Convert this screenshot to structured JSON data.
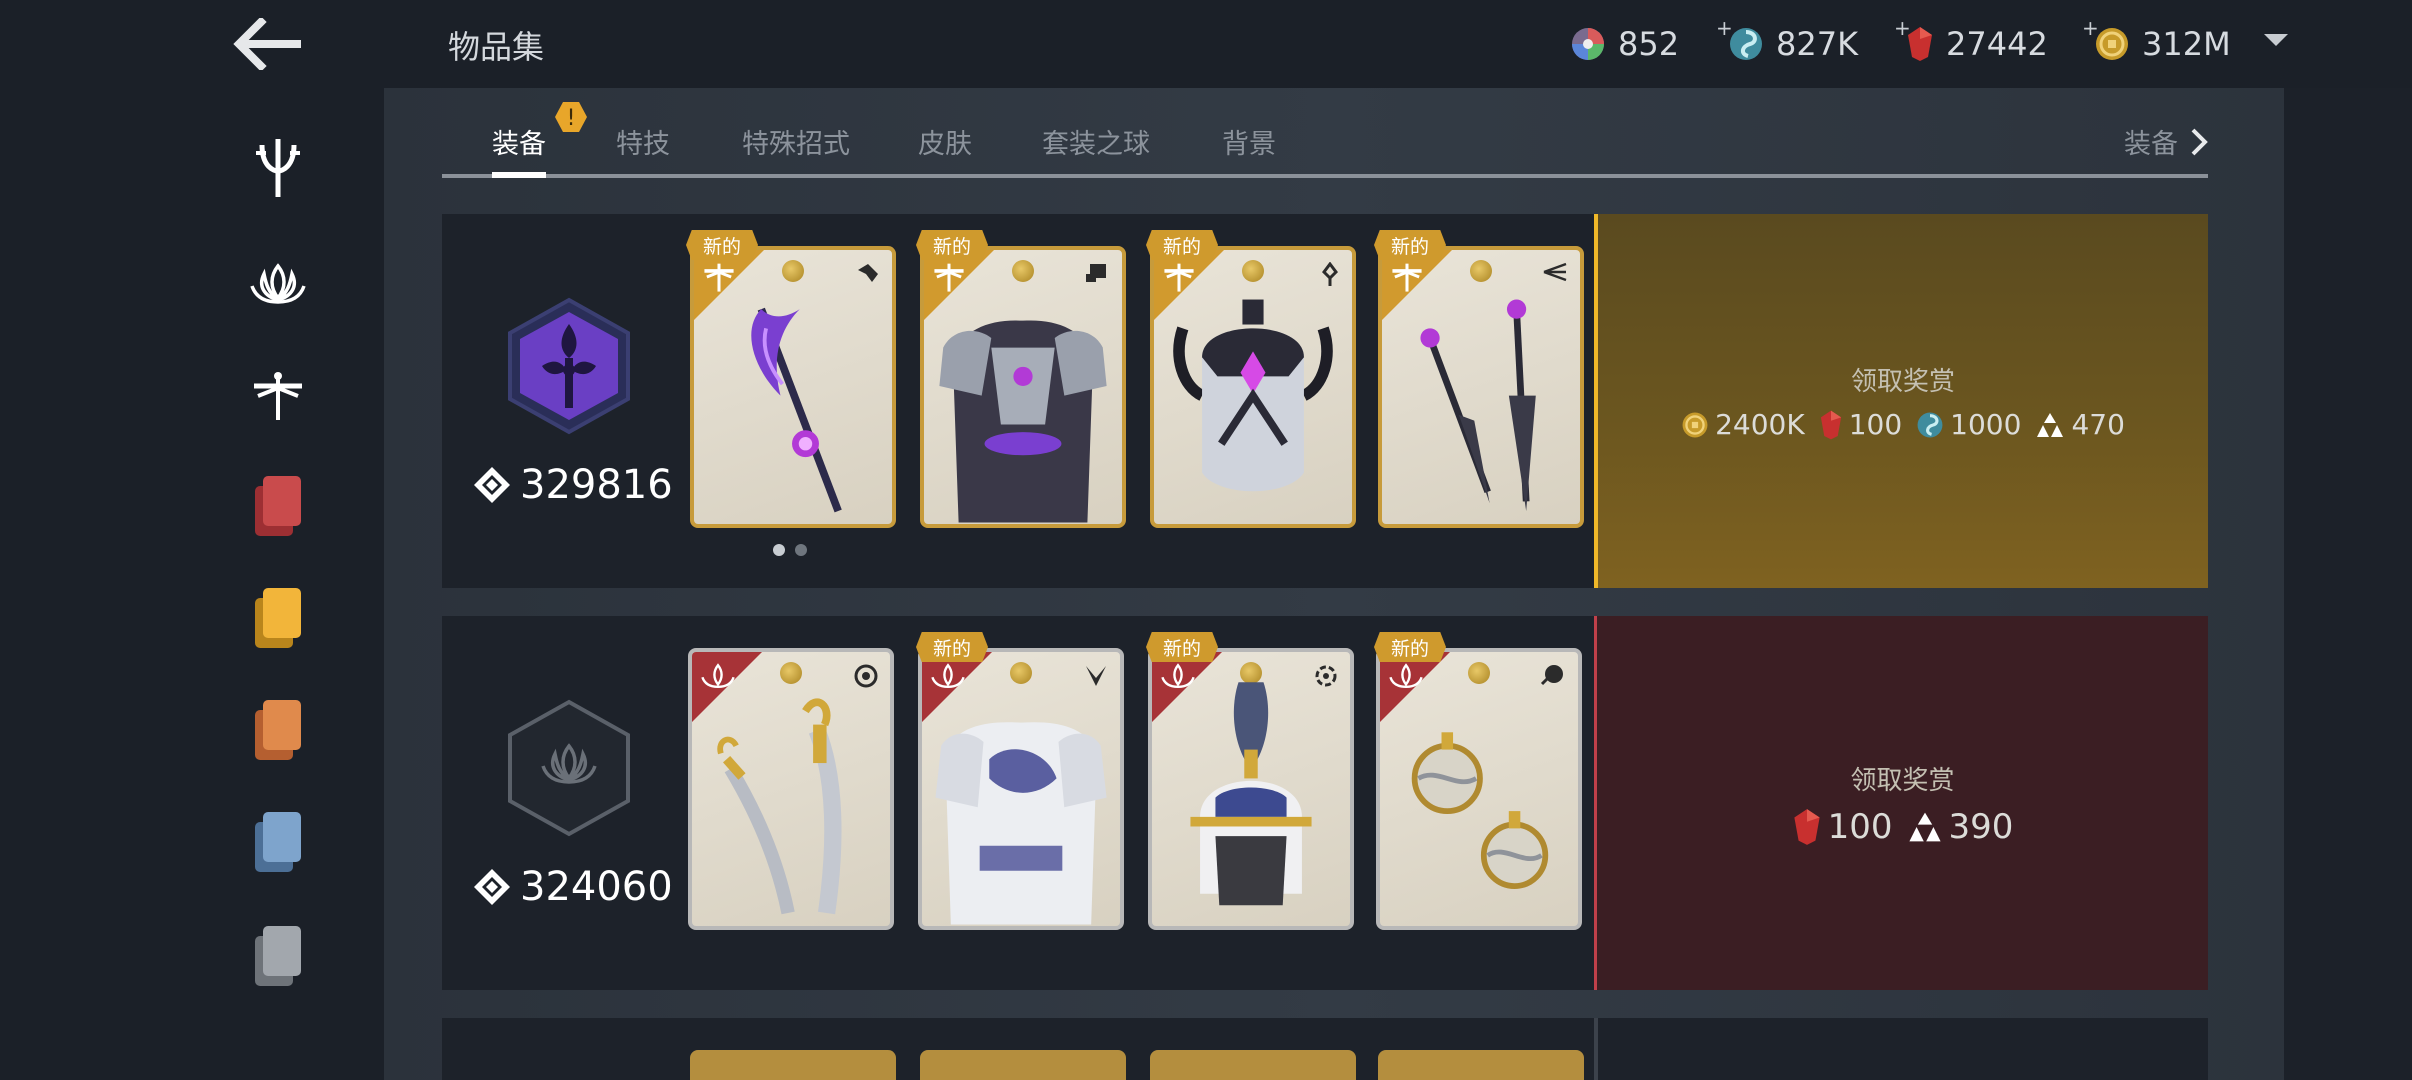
{
  "header": {
    "title": "物品集",
    "currencies": [
      {
        "icon": "rainbow-orb-icon",
        "value": "852",
        "plus": false
      },
      {
        "icon": "spiral-essence-icon",
        "value": "827K",
        "plus": true
      },
      {
        "icon": "ruby-gem-icon",
        "value": "27442",
        "plus": true
      },
      {
        "icon": "gold-coin-icon",
        "value": "312M",
        "plus": true
      }
    ],
    "plus_sign": "+"
  },
  "tabs": {
    "items": [
      "装备",
      "特技",
      "特殊招式",
      "皮肤",
      "套装之球",
      "背景"
    ],
    "active": "装备",
    "more_label": "装备",
    "warning_mark": "!"
  },
  "sidebar": {
    "items": [
      "trident-emblem-icon",
      "lotus-emblem-icon",
      "dragonfly-emblem-icon",
      "red-cards-icon",
      "yellow-cards-icon",
      "orange-cards-icon",
      "blue-cards-icon",
      "gray-cards-icon"
    ]
  },
  "sets": [
    {
      "emblem": "purple-hex-emblem-icon",
      "score": "329816",
      "new_label": "新的",
      "cards": [
        {
          "item": "polearm",
          "new": true
        },
        {
          "item": "armor",
          "new": true
        },
        {
          "item": "helmet",
          "new": true
        },
        {
          "item": "kunai",
          "new": true
        }
      ],
      "reward_title": "领取奖赏",
      "rewards": [
        {
          "icon": "gold-coin-icon",
          "value": "2400K"
        },
        {
          "icon": "ruby-gem-icon",
          "value": "100"
        },
        {
          "icon": "spiral-essence-icon",
          "value": "1000"
        },
        {
          "icon": "triangle-shards-icon",
          "value": "470"
        }
      ]
    },
    {
      "emblem": "gray-lotus-hex-emblem-icon",
      "score": "324060",
      "new_label": "新的",
      "cards": [
        {
          "item": "twin-sabres",
          "new": false
        },
        {
          "item": "robe",
          "new": true
        },
        {
          "item": "plumed-helmet",
          "new": true
        },
        {
          "item": "orb-ranged",
          "new": true
        }
      ],
      "reward_title": "领取奖赏",
      "rewards": [
        {
          "icon": "ruby-gem-icon",
          "value": "100"
        },
        {
          "icon": "triangle-shards-icon",
          "value": "390"
        }
      ]
    }
  ],
  "colors": {
    "gold_accent": "#f0b829",
    "red_accent": "#c0404a",
    "card_gold": "#d19a2e",
    "card_red": "#a73337"
  }
}
